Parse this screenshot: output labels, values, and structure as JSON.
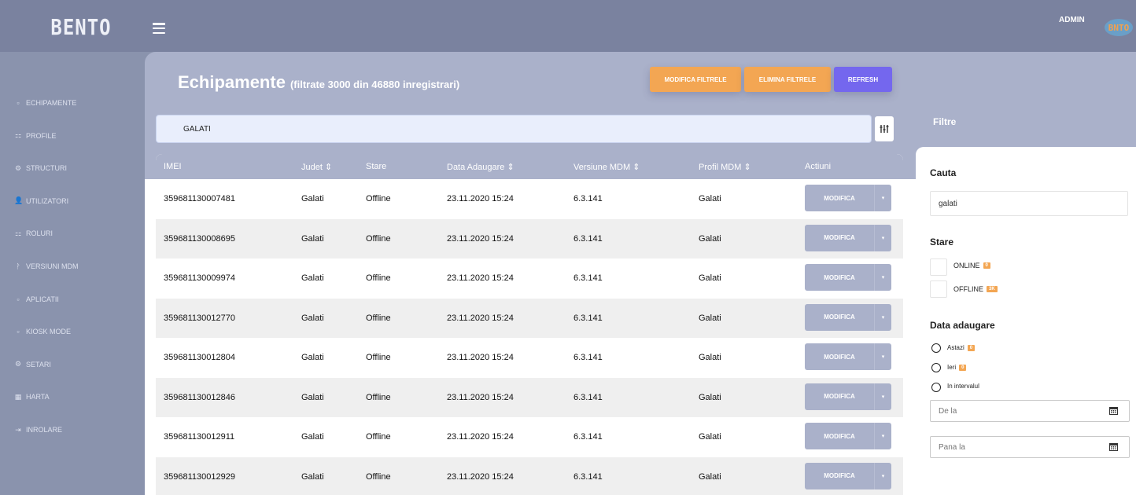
{
  "header": {
    "logo": "BENTO",
    "user": "ADMIN",
    "avatar_text": "BNTO"
  },
  "sidebar": {
    "items": [
      {
        "label": "ECHIPAMENTE",
        "icon": "▫"
      },
      {
        "label": "PROFILE",
        "icon": "⚏"
      },
      {
        "label": "STRUCTURI",
        "icon": "⚙"
      },
      {
        "label": "UTILIZATORI",
        "icon": "👤"
      },
      {
        "label": "ROLURI",
        "icon": "⚏"
      },
      {
        "label": "VERSIUNI MDM",
        "icon": "ᚹ"
      },
      {
        "label": "APLICATII",
        "icon": "▫"
      },
      {
        "label": "KIOSK MODE",
        "icon": "▫"
      },
      {
        "label": "SETARI",
        "icon": "⚙"
      },
      {
        "label": "HARTA",
        "icon": "▦"
      },
      {
        "label": "INROLARE",
        "icon": "⇥"
      }
    ]
  },
  "page": {
    "title": "Echipamente",
    "subtitle": "(filtrate 3000 din 46880 inregistrari)"
  },
  "toolbar": {
    "modify_filters": "MODIFICA FILTRELE",
    "remove_filters": "ELIMINA FILTRELE",
    "refresh": "REFRESH"
  },
  "search": {
    "value": "GALATI"
  },
  "filter_toggle_icon": "ⵊⵊⵊ",
  "table": {
    "columns": [
      "IMEI",
      "Judet ⇕",
      "Stare",
      "Data Adaugare ⇕",
      "Versiune MDM ⇕",
      "Profil MDM ⇕",
      "Actiuni"
    ],
    "action_label": "MODIFICA",
    "action_caret": "▾",
    "rows": [
      {
        "imei": "359681130007481",
        "judet": "Galati",
        "stare": "Offline",
        "data": "23.11.2020 15:24",
        "versiune": "6.3.141",
        "profil": "Galati"
      },
      {
        "imei": "359681130008695",
        "judet": "Galati",
        "stare": "Offline",
        "data": "23.11.2020 15:24",
        "versiune": "6.3.141",
        "profil": "Galati"
      },
      {
        "imei": "359681130009974",
        "judet": "Galati",
        "stare": "Offline",
        "data": "23.11.2020 15:24",
        "versiune": "6.3.141",
        "profil": "Galati"
      },
      {
        "imei": "359681130012770",
        "judet": "Galati",
        "stare": "Offline",
        "data": "23.11.2020 15:24",
        "versiune": "6.3.141",
        "profil": "Galati"
      },
      {
        "imei": "359681130012804",
        "judet": "Galati",
        "stare": "Offline",
        "data": "23.11.2020 15:24",
        "versiune": "6.3.141",
        "profil": "Galati"
      },
      {
        "imei": "359681130012846",
        "judet": "Galati",
        "stare": "Offline",
        "data": "23.11.2020 15:24",
        "versiune": "6.3.141",
        "profil": "Galati"
      },
      {
        "imei": "359681130012911",
        "judet": "Galati",
        "stare": "Offline",
        "data": "23.11.2020 15:24",
        "versiune": "6.3.141",
        "profil": "Galati"
      },
      {
        "imei": "359681130012929",
        "judet": "Galati",
        "stare": "Offline",
        "data": "23.11.2020 15:24",
        "versiune": "6.3.141",
        "profil": "Galati"
      }
    ]
  },
  "filters": {
    "title": "Filtre",
    "search_heading": "Cauta",
    "search_value": "galati",
    "status_heading": "Stare",
    "status_options": [
      {
        "label": "ONLINE",
        "count": "0"
      },
      {
        "label": "OFFLINE",
        "count": "3K"
      }
    ],
    "date_heading": "Data adaugare",
    "date_options": [
      {
        "label": "Astazi",
        "count": "0"
      },
      {
        "label": "Ieri",
        "count": "0"
      },
      {
        "label": "In intervalul",
        "count": ""
      }
    ],
    "from_placeholder": "De la",
    "to_placeholder": "Pana la",
    "calendar_icon": "▦"
  },
  "colors": {
    "sidebar": "#8a93ad",
    "topbar": "#7a829f",
    "accent_orange": "#f3a653",
    "accent_purple": "#7467ee",
    "table_header": "#aab1ca"
  }
}
